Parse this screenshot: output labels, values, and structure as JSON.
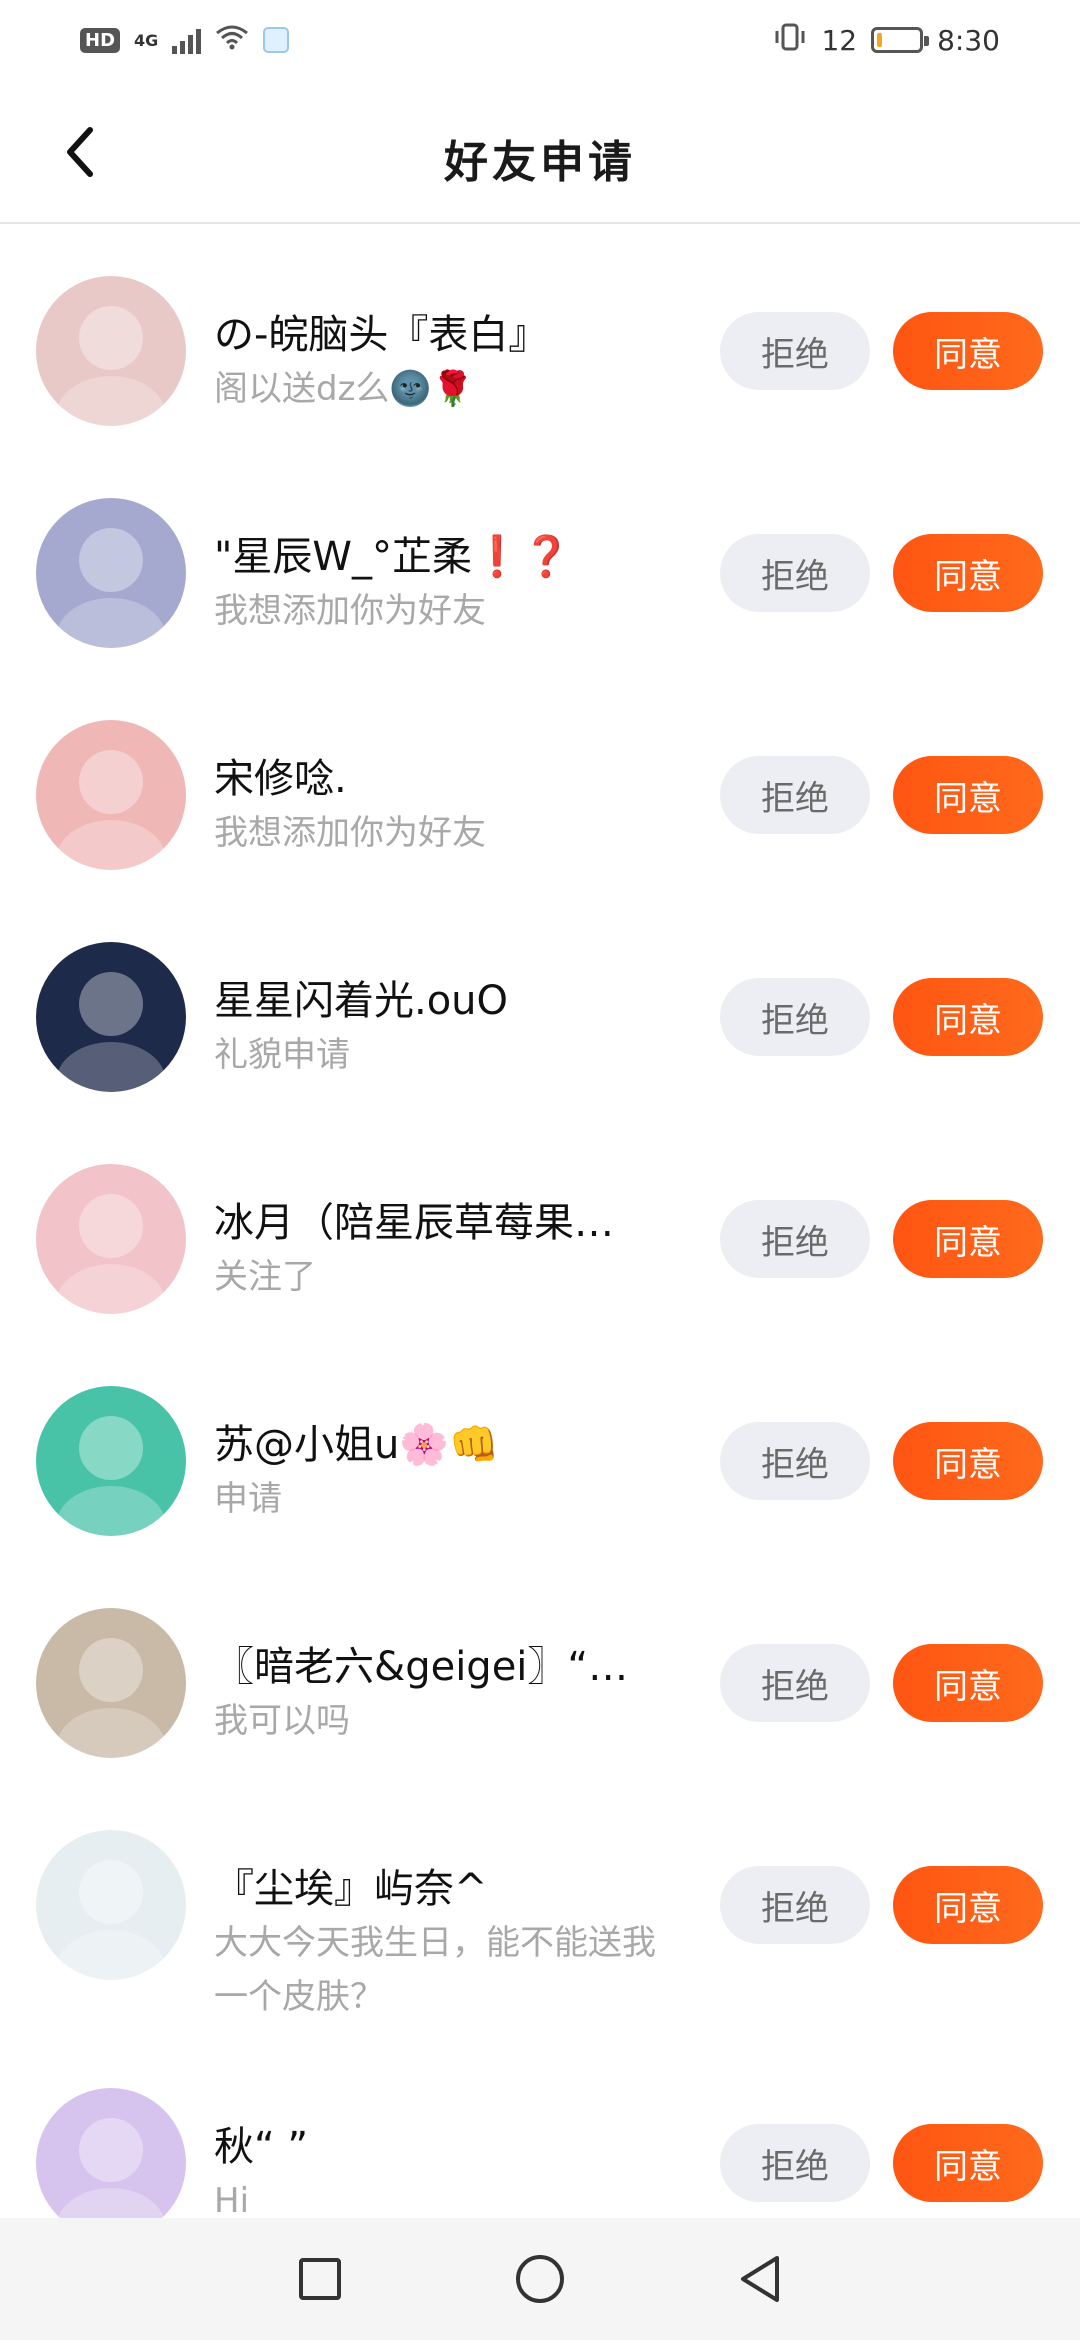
{
  "status_bar": {
    "hd": "HD",
    "network": "4G",
    "battery_level": 0.12,
    "battery_text": "12",
    "time": "8:30"
  },
  "header": {
    "title": "好友申请"
  },
  "buttons": {
    "reject": "拒绝",
    "accept": "同意"
  },
  "requests": [
    {
      "name": "の-皖脑头『表白』",
      "message": "阁以送dz么🌚🌹",
      "avatar_color": "#e8c9c7"
    },
    {
      "name": "\"星辰W_°芷柔❗❓",
      "message": "我想添加你为好友",
      "avatar_color": "#a5a9cf"
    },
    {
      "name": "宋修唸.",
      "message": "我想添加你为好友",
      "avatar_color": "#f0b7b7"
    },
    {
      "name": "星星闪着光.ouO",
      "message": "礼貌申请",
      "avatar_color": "#1e2a4a"
    },
    {
      "name": "冰月（陪星辰草莓果…",
      "message": "关注了",
      "avatar_color": "#f2c3c8"
    },
    {
      "name": "苏@小姐u🌸👊",
      "message": "申请",
      "avatar_color": "#49c3a8"
    },
    {
      "name": "〖暗老六&geigei〗“…",
      "message": "我可以吗",
      "avatar_color": "#c9b9a7"
    },
    {
      "name": "『尘埃』屿奈^",
      "message": "大大今天我生日，能不能送我一个皮肤？",
      "avatar_color": "#e7eef2"
    },
    {
      "name": "秋“ ”",
      "message": "Hi",
      "avatar_color": "#d7c4ee"
    }
  ]
}
